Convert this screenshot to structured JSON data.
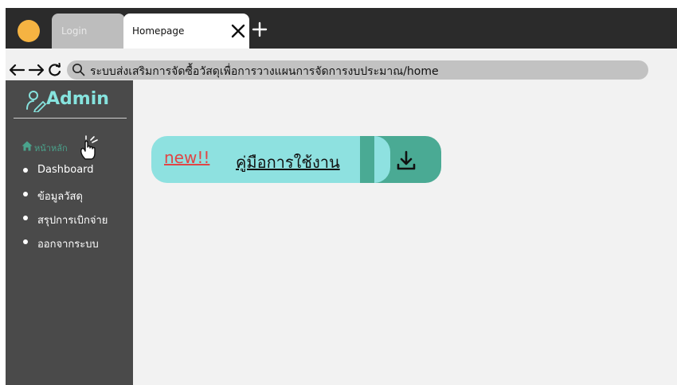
{
  "browser": {
    "tabs": [
      {
        "label": "Login",
        "active": false
      },
      {
        "label": "Homepage",
        "active": true
      }
    ],
    "close_tab_symbol": "✕",
    "new_tab_symbol": "+",
    "nav": {
      "back": "←",
      "forward": "→",
      "reload": "↻"
    },
    "address": "ระบบส่งเสริมการจัดซื้อวัสดุเพื่อการวางแผนการจัดการงบประมาณ/home"
  },
  "sidebar": {
    "brand": "Admin",
    "home_label": "หน้าหลัก",
    "items": [
      {
        "label": "Dashboard"
      },
      {
        "label": "ข้อมูลวัสดุ"
      },
      {
        "label": "สรุปการเบิกจ่าย"
      },
      {
        "label": "ออกจากระบบ"
      }
    ]
  },
  "main": {
    "new_badge": "new!!",
    "manual_link": "คู่มือการใช้งาน"
  },
  "colors": {
    "accent_teal": "#86e3de",
    "button_light": "#8ee1e0",
    "button_dark": "#4aaa94",
    "new_red": "#e04646",
    "sidebar_bg": "#4a4a4a",
    "home_green": "#4aa38c",
    "traffic_dot": "#f5b342"
  },
  "icons": {
    "brand": "user-pen-icon",
    "home": "home-icon",
    "download": "download-icon",
    "cursor": "hand-pointer-icon",
    "search": "search-icon"
  }
}
